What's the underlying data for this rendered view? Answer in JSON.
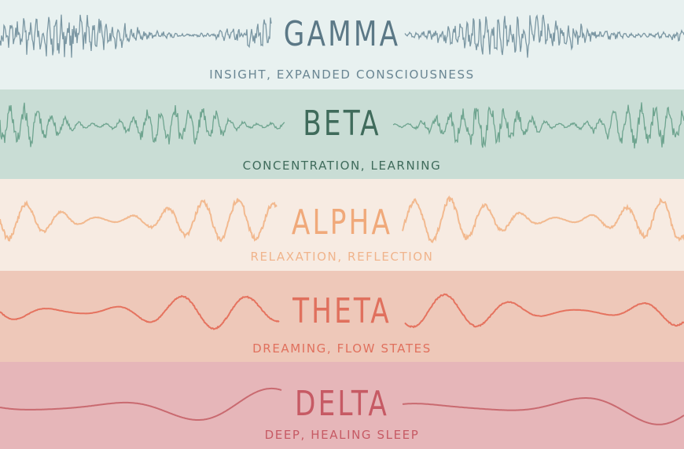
{
  "bands": [
    {
      "id": "gamma",
      "name": "GAMMA",
      "description": "INSIGHT, EXPANDED CONSCIOUSNESS",
      "background": "#e8f1f0",
      "wave_color": "#7b97a3",
      "text_color": "#5b7886",
      "desc_color": "#6a8693"
    },
    {
      "id": "beta",
      "name": "BETA",
      "description": "CONCENTRATION, LEARNING",
      "background": "#c9ddd5",
      "wave_color": "#6ea48f",
      "text_color": "#3f6b5b",
      "desc_color": "#3f6b5b"
    },
    {
      "id": "alpha",
      "name": "ALPHA",
      "description": "RELAXATION, REFLECTION",
      "background": "#f7ebe2",
      "wave_color": "#f2b98f",
      "text_color": "#f0a97a",
      "desc_color": "#f0b48c"
    },
    {
      "id": "theta",
      "name": "THETA",
      "description": "DREAMING, FLOW STATES",
      "background": "#eec8b9",
      "wave_color": "#e5735f",
      "text_color": "#e0705d",
      "desc_color": "#e0705d"
    },
    {
      "id": "delta",
      "name": "DELTA",
      "description": "DEEP, HEALING SLEEP",
      "background": "#e6b6b9",
      "wave_color": "#c96a70",
      "text_color": "#c65a64",
      "desc_color": "#c65a64"
    }
  ]
}
